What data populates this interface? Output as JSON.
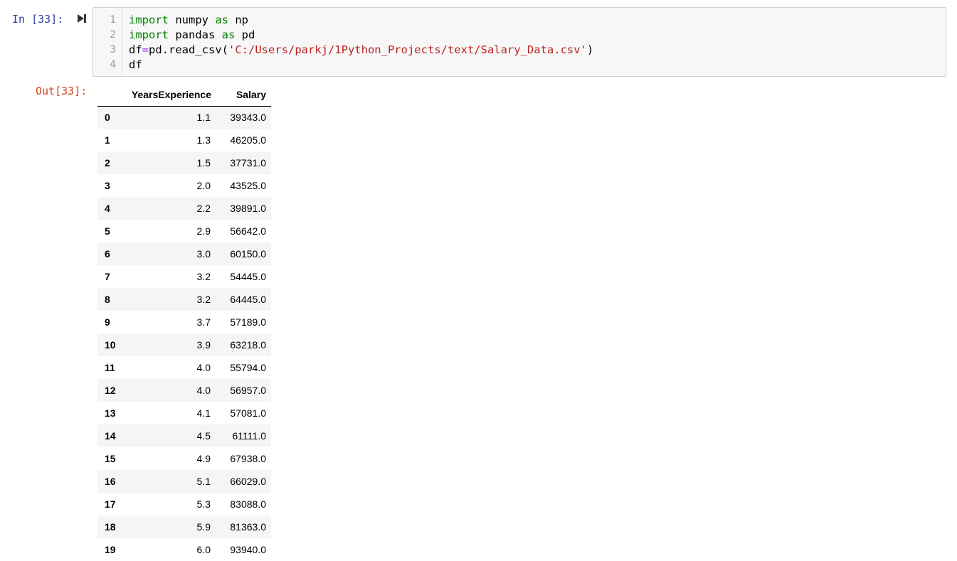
{
  "input_prompt": "In [33]:",
  "output_prompt": "Out[33]:",
  "code_lines": [
    {
      "num": "1",
      "tokens": [
        {
          "t": "import",
          "c": "kw"
        },
        {
          "t": " numpy ",
          "c": ""
        },
        {
          "t": "as",
          "c": "kw"
        },
        {
          "t": " np",
          "c": ""
        }
      ]
    },
    {
      "num": "2",
      "tokens": [
        {
          "t": "import",
          "c": "kw"
        },
        {
          "t": " pandas ",
          "c": ""
        },
        {
          "t": "as",
          "c": "kw"
        },
        {
          "t": " pd",
          "c": ""
        }
      ]
    },
    {
      "num": "3",
      "tokens": [
        {
          "t": "df",
          "c": ""
        },
        {
          "t": "=",
          "c": "op"
        },
        {
          "t": "pd.read_csv(",
          "c": ""
        },
        {
          "t": "'C:/Users/parkj/1Python_Projects/text/Salary_Data.csv'",
          "c": "str"
        },
        {
          "t": ")",
          "c": ""
        }
      ]
    },
    {
      "num": "4",
      "tokens": [
        {
          "t": "df",
          "c": ""
        }
      ]
    }
  ],
  "table": {
    "columns": [
      "YearsExperience",
      "Salary"
    ],
    "rows": [
      {
        "index": "0",
        "years": "1.1",
        "salary": "39343.0"
      },
      {
        "index": "1",
        "years": "1.3",
        "salary": "46205.0"
      },
      {
        "index": "2",
        "years": "1.5",
        "salary": "37731.0"
      },
      {
        "index": "3",
        "years": "2.0",
        "salary": "43525.0"
      },
      {
        "index": "4",
        "years": "2.2",
        "salary": "39891.0"
      },
      {
        "index": "5",
        "years": "2.9",
        "salary": "56642.0"
      },
      {
        "index": "6",
        "years": "3.0",
        "salary": "60150.0"
      },
      {
        "index": "7",
        "years": "3.2",
        "salary": "54445.0"
      },
      {
        "index": "8",
        "years": "3.2",
        "salary": "64445.0"
      },
      {
        "index": "9",
        "years": "3.7",
        "salary": "57189.0"
      },
      {
        "index": "10",
        "years": "3.9",
        "salary": "63218.0"
      },
      {
        "index": "11",
        "years": "4.0",
        "salary": "55794.0"
      },
      {
        "index": "12",
        "years": "4.0",
        "salary": "56957.0"
      },
      {
        "index": "13",
        "years": "4.1",
        "salary": "57081.0"
      },
      {
        "index": "14",
        "years": "4.5",
        "salary": "61111.0"
      },
      {
        "index": "15",
        "years": "4.9",
        "salary": "67938.0"
      },
      {
        "index": "16",
        "years": "5.1",
        "salary": "66029.0"
      },
      {
        "index": "17",
        "years": "5.3",
        "salary": "83088.0"
      },
      {
        "index": "18",
        "years": "5.9",
        "salary": "81363.0"
      },
      {
        "index": "19",
        "years": "6.0",
        "salary": "93940.0"
      }
    ]
  },
  "icons": {
    "run": "step-forward-icon"
  },
  "colors": {
    "keyword": "#008000",
    "string": "#ba2121",
    "operator": "#aa22ff",
    "input_prompt": "#303f9f",
    "output_prompt": "#d84315"
  }
}
